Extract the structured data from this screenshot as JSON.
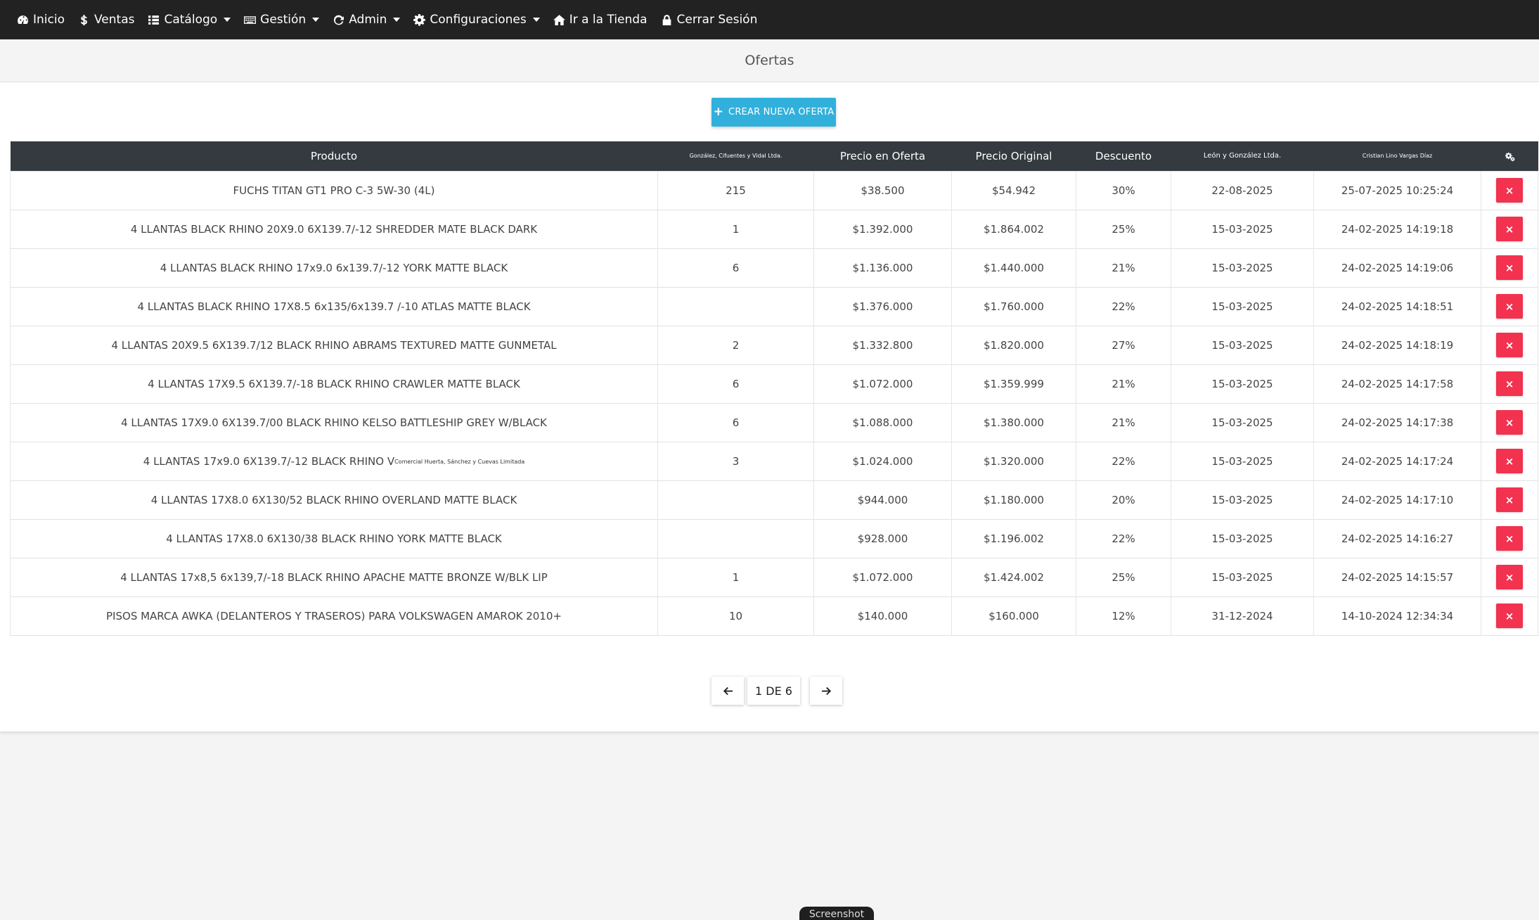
{
  "nav": {
    "items": [
      {
        "label": "Inicio",
        "icon": "dashboard-icon",
        "dropdown": false
      },
      {
        "label": "Ventas",
        "icon": "dollar-icon",
        "dropdown": false
      },
      {
        "label": "Catálogo",
        "icon": "list-icon",
        "dropdown": true
      },
      {
        "label": "Gestión",
        "icon": "keyboard-icon",
        "dropdown": true
      },
      {
        "label": "Admin",
        "icon": "refresh-icon",
        "dropdown": true
      },
      {
        "label": "Configuraciones",
        "icon": "gear-icon",
        "dropdown": true
      },
      {
        "label": "Ir a la Tienda",
        "icon": "home-icon",
        "dropdown": false
      },
      {
        "label": "Cerrar Sesión",
        "icon": "lock-icon",
        "dropdown": false
      }
    ]
  },
  "page": {
    "title": "Ofertas"
  },
  "actions": {
    "create_label": "CREAR NUEVA OFERTA",
    "create_icon": "plus-icon"
  },
  "table": {
    "headers": {
      "producto": "Producto",
      "col2": "González, Cifuentes y Vidal Ltda.",
      "precio_oferta": "Precio en Oferta",
      "precio_original": "Precio Original",
      "descuento": "Descuento",
      "col6": "León y González Ltda.",
      "col7": "Cristian Lino Vargas Díaz",
      "actions_icon": "settings-icon"
    },
    "rows": [
      {
        "producto": "FUCHS TITAN GT1 PRO C-3 5W-30 (4L)",
        "cantidad": "215",
        "precio_oferta": "$38.500",
        "precio_original": "$54.942",
        "descuento": "30%",
        "fecha_fin": "22-08-2025",
        "creado": "25-07-2025 10:25:24"
      },
      {
        "producto": "4 LLANTAS BLACK RHINO 20X9.0 6X139.7/-12 SHREDDER MATE BLACK DARK",
        "cantidad": "1",
        "precio_oferta": "$1.392.000",
        "precio_original": "$1.864.002",
        "descuento": "25%",
        "fecha_fin": "15-03-2025",
        "creado": "24-02-2025 14:19:18"
      },
      {
        "producto": "4 LLANTAS BLACK RHINO 17x9.0 6x139.7/-12 YORK MATTE BLACK",
        "cantidad": "6",
        "precio_oferta": "$1.136.000",
        "precio_original": "$1.440.000",
        "descuento": "21%",
        "fecha_fin": "15-03-2025",
        "creado": "24-02-2025 14:19:06"
      },
      {
        "producto": "4 LLANTAS BLACK RHINO 17X8.5 6x135/6x139.7 /-10 ATLAS MATTE BLACK",
        "cantidad": "",
        "precio_oferta": "$1.376.000",
        "precio_original": "$1.760.000",
        "descuento": "22%",
        "fecha_fin": "15-03-2025",
        "creado": "24-02-2025 14:18:51"
      },
      {
        "producto": "4 LLANTAS 20X9.5 6X139.7/12 BLACK RHINO ABRAMS TEXTURED MATTE GUNMETAL",
        "cantidad": "2",
        "precio_oferta": "$1.332.800",
        "precio_original": "$1.820.000",
        "descuento": "27%",
        "fecha_fin": "15-03-2025",
        "creado": "24-02-2025 14:18:19"
      },
      {
        "producto": "4 LLANTAS 17X9.5 6X139.7/-18 BLACK RHINO CRAWLER MATTE BLACK",
        "cantidad": "6",
        "precio_oferta": "$1.072.000",
        "precio_original": "$1.359.999",
        "descuento": "21%",
        "fecha_fin": "15-03-2025",
        "creado": "24-02-2025 14:17:58"
      },
      {
        "producto": "4 LLANTAS 17X9.0 6X139.7/00 BLACK RHINO KELSO BATTLESHIP GREY W/BLACK",
        "cantidad": "6",
        "precio_oferta": "$1.088.000",
        "precio_original": "$1.380.000",
        "descuento": "21%",
        "fecha_fin": "15-03-2025",
        "creado": "24-02-2025 14:17:38"
      },
      {
        "producto": "4 LLANTAS 17x9.0 6X139.7/-12 BLACK RHINO V",
        "producto_overlay": "Comercial Huerta, Sánchez y Cuevas Limitada",
        "cantidad": "3",
        "precio_oferta": "$1.024.000",
        "precio_original": "$1.320.000",
        "descuento": "22%",
        "fecha_fin": "15-03-2025",
        "creado": "24-02-2025 14:17:24"
      },
      {
        "producto": "4 LLANTAS 17X8.0 6X130/52 BLACK RHINO OVERLAND MATTE BLACK",
        "cantidad": "",
        "precio_oferta": "$944.000",
        "precio_original": "$1.180.000",
        "descuento": "20%",
        "fecha_fin": "15-03-2025",
        "creado": "24-02-2025 14:17:10"
      },
      {
        "producto": "4 LLANTAS 17X8.0 6X130/38 BLACK RHINO YORK MATTE BLACK",
        "cantidad": "",
        "precio_oferta": "$928.000",
        "precio_original": "$1.196.002",
        "descuento": "22%",
        "fecha_fin": "15-03-2025",
        "creado": "24-02-2025 14:16:27"
      },
      {
        "producto": "4 LLANTAS 17x8,5 6x139,7/-18 BLACK RHINO APACHE MATTE BRONZE W/BLK LIP",
        "cantidad": "1",
        "precio_oferta": "$1.072.000",
        "precio_original": "$1.424.002",
        "descuento": "25%",
        "fecha_fin": "15-03-2025",
        "creado": "24-02-2025 14:15:57"
      },
      {
        "producto": "PISOS MARCA AWKA (DELANTEROS Y TRASEROS) PARA VOLKSWAGEN AMAROK 2010+",
        "cantidad": "10",
        "precio_oferta": "$140.000",
        "precio_original": "$160.000",
        "descuento": "12%",
        "fecha_fin": "31-12-2024",
        "creado": "14-10-2024 12:34:34"
      }
    ],
    "delete_label": "×"
  },
  "pagination": {
    "prev_icon": "arrow-left-icon",
    "current": "1 DE 6",
    "next_icon": "arrow-right-icon"
  },
  "screenshot_badge": "Screenshot",
  "colors": {
    "navbar_bg": "#222222",
    "table_header_bg": "#343a40",
    "primary_button": "#31b0dc",
    "danger_button": "#f2324e",
    "expired_date": "#f05a6e"
  }
}
